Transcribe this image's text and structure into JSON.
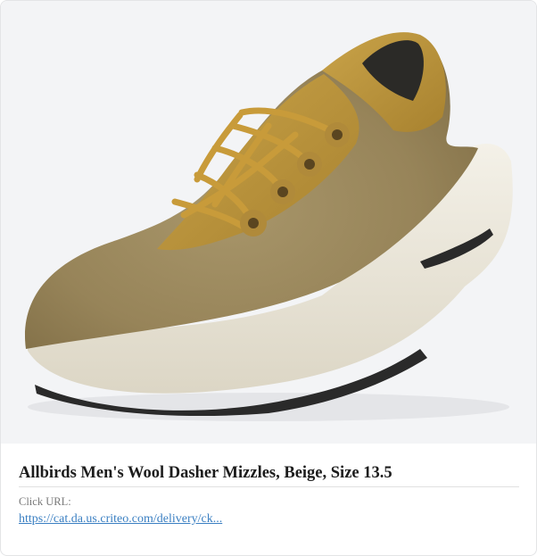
{
  "product": {
    "title": "Allbirds Men's Wool Dasher Mizzles, Beige, Size 13.5",
    "image_subject": "sneaker-product-image"
  },
  "click": {
    "label": "Click URL:",
    "url_text": "https://cat.da.us.criteo.com/delivery/ck..."
  },
  "colors": {
    "image_background": "#f3f4f6",
    "upper": "#9c8a5e",
    "sole": "#efebe0",
    "link": "#3a7fc2"
  }
}
